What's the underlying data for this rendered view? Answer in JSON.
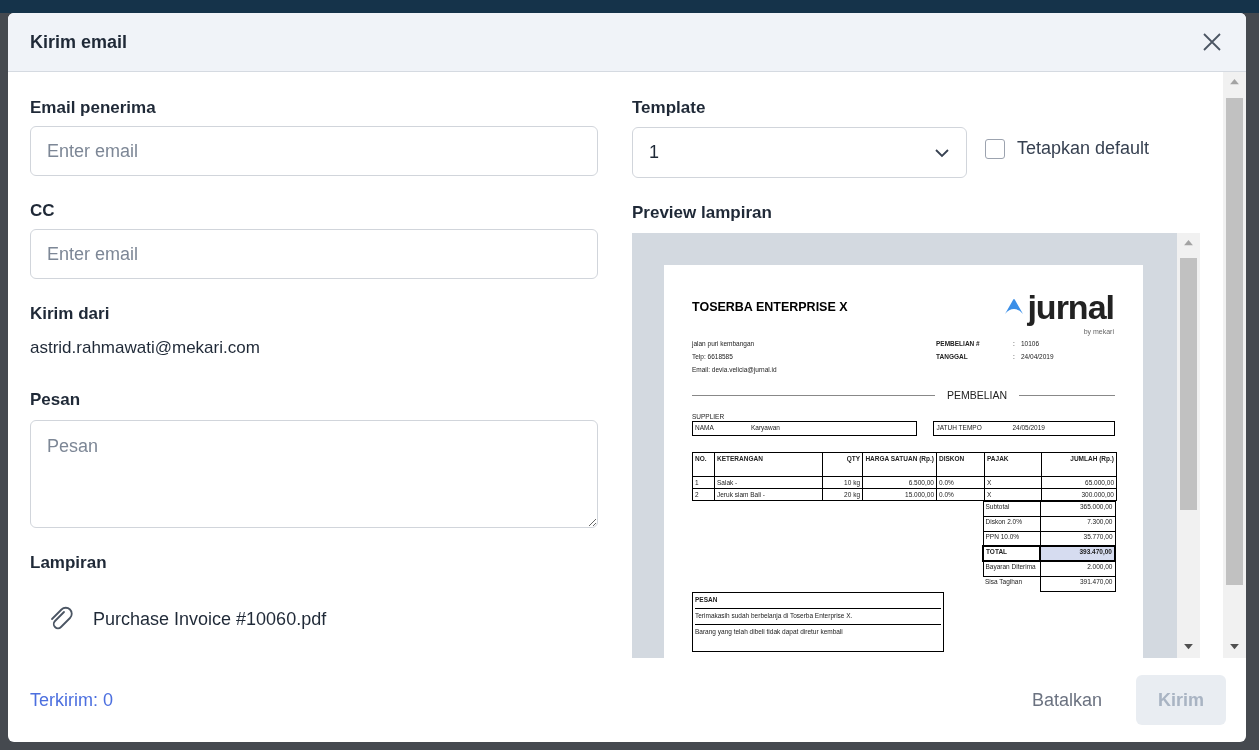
{
  "dialog": {
    "title": "Kirim email"
  },
  "left": [
    {
      "kind": "input",
      "label": "Email penerima",
      "placeholder": "Enter email"
    },
    {
      "kind": "input",
      "label": "CC",
      "placeholder": "Enter email"
    },
    {
      "kind": "text",
      "label": "Kirim dari",
      "value": "astrid.rahmawati@mekari.com"
    },
    {
      "kind": "textarea",
      "label": "Pesan",
      "placeholder": "Pesan"
    },
    {
      "kind": "files",
      "label": "Lampiran",
      "files": [
        "Purchase Invoice #10060.pdf"
      ]
    }
  ],
  "template": {
    "label": "Template",
    "value": "1"
  },
  "set_default": {
    "label": "Tetapkan default",
    "checked": false
  },
  "preview": {
    "label": "Preview lampiran",
    "document": {
      "company": "TOSERBA ENTERPRISE X",
      "logo_word": "jurnal",
      "logo_tagline": "by mekari",
      "address_lines": [
        "jalan puri kembangan",
        "Telp: 6618585",
        "Email: devia.velicia@jurnal.id"
      ],
      "meta": [
        {
          "label": "PEMBELIAN #",
          "separator": ":",
          "value": "10106"
        },
        {
          "label": "TANGGAL",
          "separator": ":",
          "value": "24/04/2019"
        }
      ],
      "heading": "PEMBELIAN",
      "supplier_title": "SUPPLIER",
      "supplier": {
        "label": "NAMA",
        "value": "Karyawan"
      },
      "due": {
        "label": "JATUH TEMPO",
        "value": "24/05/2019"
      },
      "columns": [
        "NO.",
        "KETERANGAN",
        "QTY",
        "HARGA SATUAN (Rp.)",
        "DISKON",
        "PAJAK",
        "JUMLAH (Rp.)"
      ],
      "rows": [
        [
          "1",
          "Salak -",
          "10 kg",
          "6.500,00",
          "0.0%",
          "X",
          "65.000,00"
        ],
        [
          "2",
          "Jeruk siam Bali -",
          "20 kg",
          "15.000,00",
          "0.0%",
          "X",
          "300.000,00"
        ]
      ],
      "summary": [
        {
          "kind": "normal",
          "label": "Subtotal",
          "value": "365.000,00"
        },
        {
          "kind": "normal",
          "label": "Diskon 2.0%",
          "value": "7.300,00"
        },
        {
          "kind": "normal",
          "label": "PPN 10.0%",
          "value": "35.770,00"
        },
        {
          "kind": "total",
          "label": "TOTAL",
          "value": "393.470,00"
        },
        {
          "kind": "normal",
          "label": "Bayaran Diterima",
          "value": "2.000,00"
        },
        {
          "kind": "balance",
          "label": "Sisa Tagihan",
          "value": "391.470,00"
        }
      ],
      "message": {
        "title": "PESAN",
        "lines": [
          "Terimakasih sudah berbelanja di Toserba Enterprise X.",
          "Barang yang telah dibeli tidak dapat diretur kembali"
        ]
      }
    }
  },
  "footer": {
    "sent_count": "Terkirim: 0",
    "buttons": [
      {
        "label": "Batalkan",
        "kind": "text",
        "disabled": false
      },
      {
        "label": "Kirim",
        "kind": "primary",
        "disabled": true
      }
    ]
  }
}
